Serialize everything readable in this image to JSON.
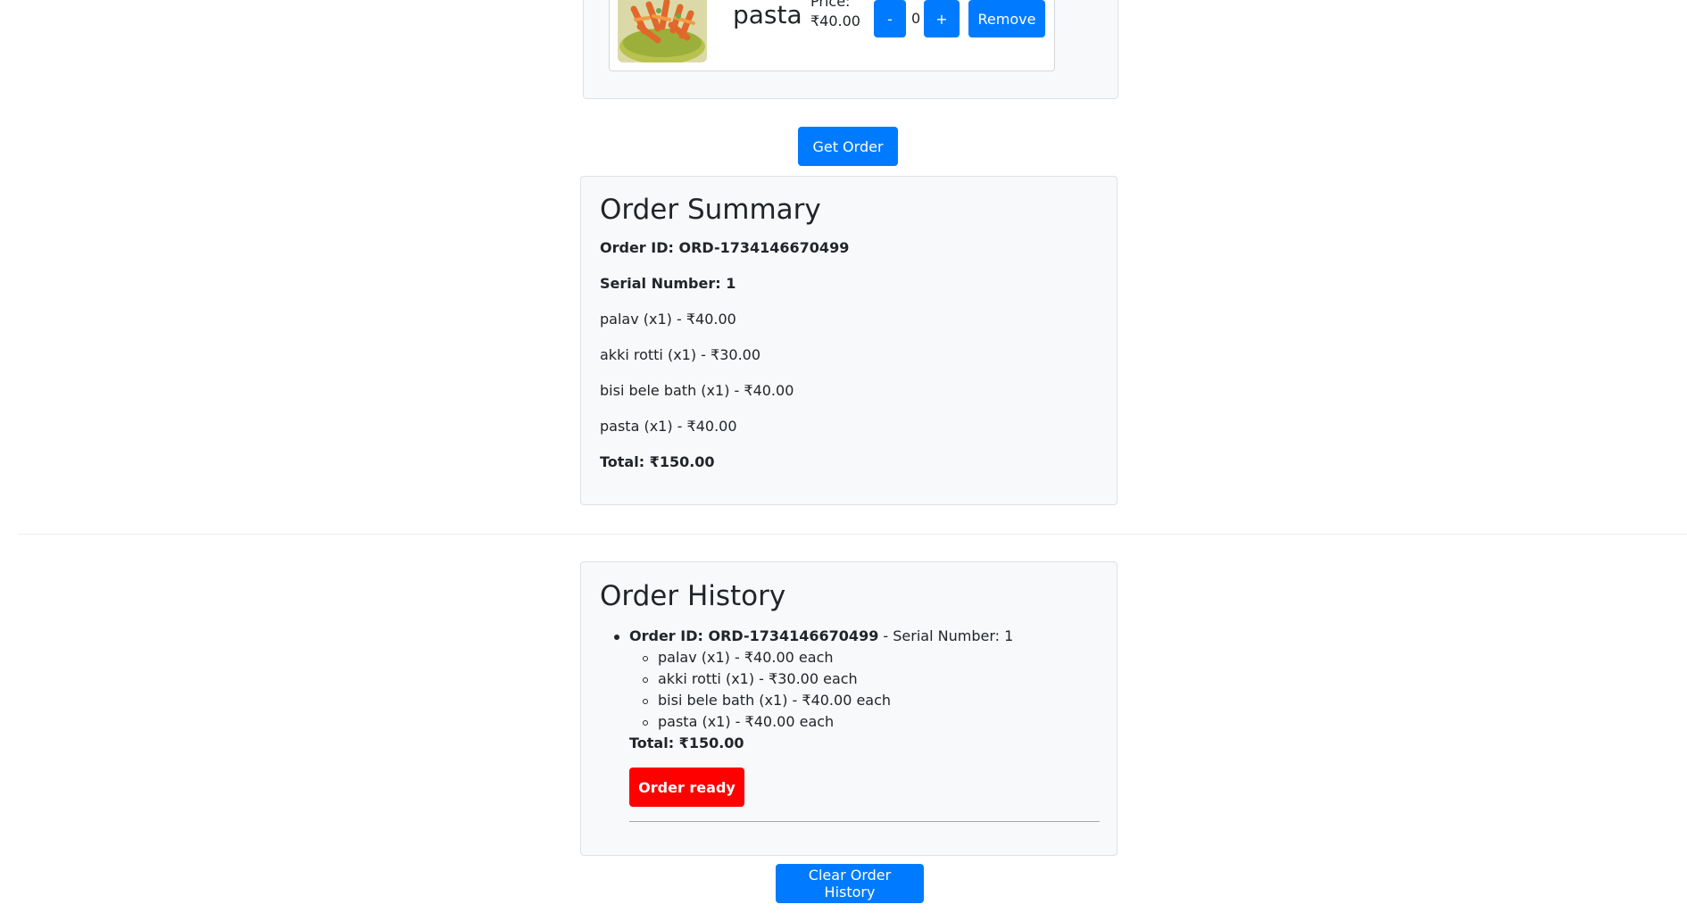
{
  "cart": {
    "item": {
      "name": "pasta",
      "price_label": "Price:",
      "price": "₹40.00",
      "quantity": "0",
      "image_icon": "pasta-bowl-image"
    },
    "minus_label": "-",
    "plus_label": "+",
    "remove_label": "Remove"
  },
  "get_order_label": "Get Order",
  "summary": {
    "title": "Order Summary",
    "order_id": "Order ID: ORD-1734146670499",
    "serial": "Serial Number: 1",
    "items": [
      "palav (x1) - ₹40.00",
      "akki rotti (x1) - ₹30.00",
      "bisi bele bath (x1) - ₹40.00",
      "pasta (x1) - ₹40.00"
    ],
    "total": "Total: ₹150.00"
  },
  "history": {
    "title": "Order History",
    "orders": [
      {
        "order_id": "Order ID: ORD-1734146670499",
        "serial": " - Serial Number: 1",
        "items": [
          "palav (x1) - ₹40.00 each",
          "akki rotti (x1) - ₹30.00 each",
          "bisi bele bath (x1) - ₹40.00 each",
          "pasta (x1) - ₹40.00 each"
        ],
        "total": "Total: ₹150.00",
        "ready_label": "Order ready"
      }
    ],
    "clear_label": "Clear Order History"
  },
  "colors": {
    "primary": "#007bff",
    "danger": "#ff0000"
  }
}
